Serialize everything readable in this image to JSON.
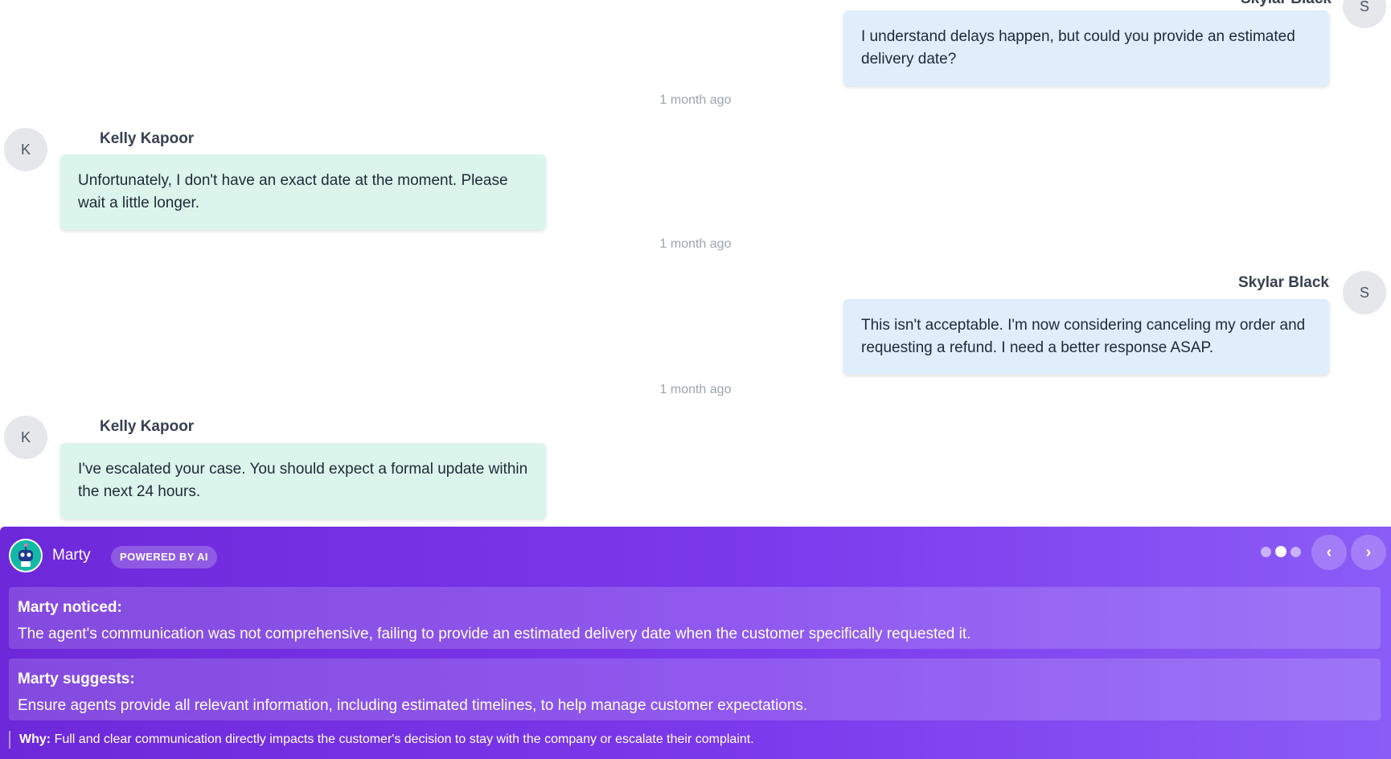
{
  "messages": [
    {
      "sender": "Skylar Black",
      "role": "customer",
      "avatar": "S",
      "text": "I understand delays happen, but could you provide an estimated delivery date?",
      "time": "1 month ago"
    },
    {
      "sender": "Kelly Kapoor",
      "role": "agent",
      "avatar": "K",
      "text": "Unfortunately, I don't have an exact date at the moment. Please wait a little longer.",
      "time": "1 month ago"
    },
    {
      "sender": "Skylar Black",
      "role": "customer",
      "avatar": "S",
      "text": "This isn't acceptable. I'm now considering canceling my order and requesting a refund. I need a better response ASAP.",
      "time": "1 month ago"
    },
    {
      "sender": "Kelly Kapoor",
      "role": "agent",
      "avatar": "K",
      "text": "I've escalated your case. You should expect a formal update within the next 24 hours."
    }
  ],
  "marty": {
    "name": "Marty",
    "badge": "POWERED BY AI",
    "pager": {
      "total": 3,
      "active_index": 1
    },
    "prev_icon": "chevron-left-icon",
    "next_icon": "chevron-right-icon",
    "prev_label": "‹",
    "next_label": "›",
    "noticed_title": "Marty noticed:",
    "noticed_text": "The agent's communication was not comprehensive, failing to provide an estimated delivery date when the customer specifically requested it.",
    "suggests_title": "Marty suggests:",
    "suggests_text": "Ensure agents provide all relevant information, including estimated timelines, to help manage customer expectations.",
    "why_label": "Why:",
    "why_text": "Full and clear communication directly impacts the customer's decision to stay with the company or escalate their complaint."
  },
  "colors": {
    "agent_bubble": "#dcf5ec",
    "customer_bubble": "#e0edfb",
    "marty_gradient_start": "#6d28d9",
    "marty_gradient_end": "#8b5cf6"
  }
}
